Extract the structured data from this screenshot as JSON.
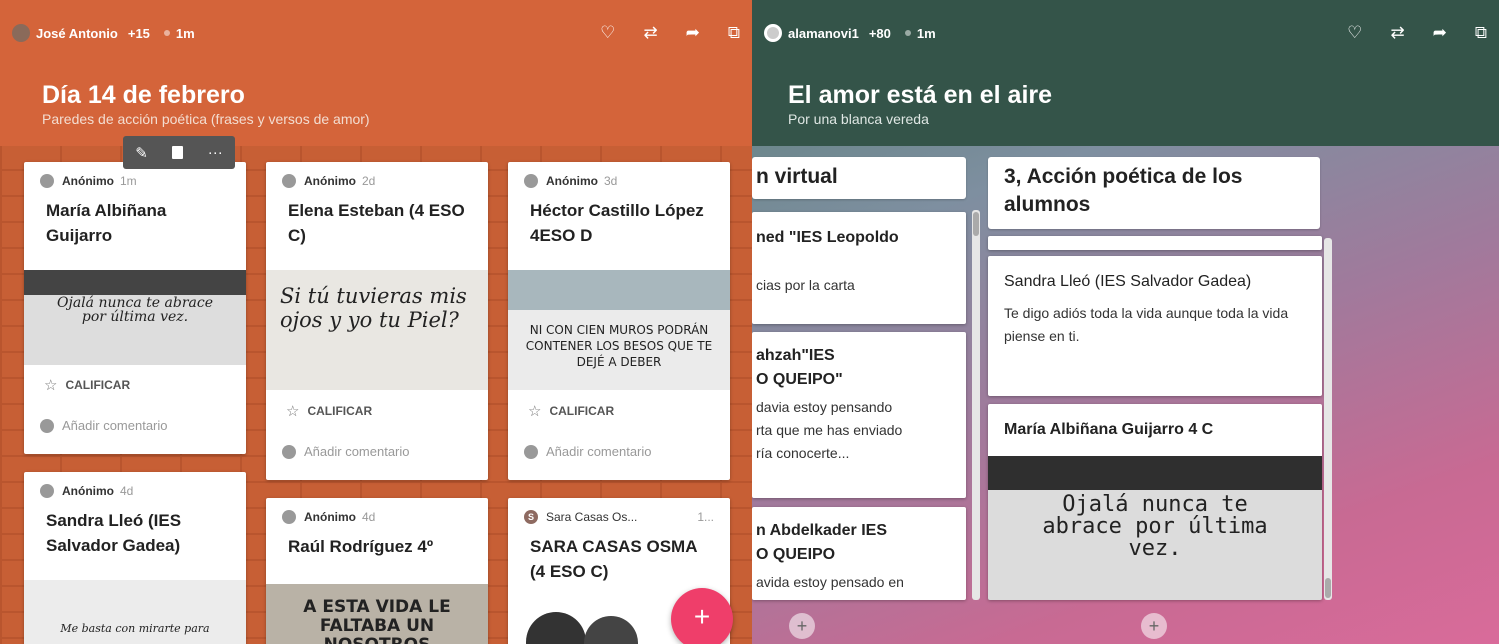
{
  "left": {
    "topbar": {
      "user": "José Antonio",
      "count": "+15",
      "time": "1m"
    },
    "header": {
      "title": "Día 14 de febrero",
      "subtitle": "Paredes de acción poética (frases y versos de amor)"
    },
    "toolbar": {
      "edit": "✎",
      "delete": "🗑",
      "more": "···"
    },
    "cards": [
      {
        "author": "Anónimo",
        "time": "1m",
        "title": "María Albiñana Guijarro",
        "image_text": "Ojalá nunca te abrace por última vez.",
        "rate": "CALIFICAR",
        "comment": "Añadir comentario"
      },
      {
        "author": "Anónimo",
        "time": "2d",
        "title": "Elena Esteban (4 ESO C)",
        "image_text": "Si tú tuvieras mis ojos y yo tu Piel?",
        "rate": "CALIFICAR",
        "comment": "Añadir comentario"
      },
      {
        "author": "Anónimo",
        "time": "3d",
        "title": "Héctor Castillo López 4ESO D",
        "image_text": "NI CON CIEN MUROS PODRÁN CONTENER LOS BESOS QUE TE DEJÉ A DEBER",
        "rate": "CALIFICAR",
        "comment": "Añadir comentario"
      },
      {
        "author": "Anónimo",
        "time": "4d",
        "title": "Sandra Lleó (IES Salvador Gadea)",
        "image_text": "Me basta con mirarte para"
      },
      {
        "author": "Anónimo",
        "time": "4d",
        "title": "Raúl Rodríguez 4º",
        "image_text": "A ESTA VIDA LE FALTABA UN NOSOTROS"
      },
      {
        "author": "Sara Casas Os...",
        "time": "1...",
        "title": "SARA CASAS OSMA (4 ESO C)",
        "avatar_letter": "S"
      }
    ],
    "fab": "+"
  },
  "right": {
    "topbar": {
      "user": "alamanovi1",
      "count": "+80",
      "time": "1m"
    },
    "header": {
      "title": "El amor está en el aire",
      "subtitle": "Por una blanca vereda"
    },
    "col1": {
      "header": "n virtual",
      "cards": [
        {
          "title": "ned \"IES Leopoldo",
          "body": "cias por la carta"
        },
        {
          "title": "ahzah\"IES\nO QUEIPO\"",
          "body": "davia estoy pensando\nrta que me has enviado\nría conocerte..."
        },
        {
          "title": "n Abdelkader IES\nO QUEIPO",
          "body": "avida estoy pensado en"
        }
      ]
    },
    "col2": {
      "header": "3, Acción poética de los alumnos",
      "cards": [
        {
          "title": "Sandra Lleó (IES Salvador Gadea)",
          "body": "Te digo adiós toda la vida aunque toda la vida piense en ti."
        },
        {
          "title": "María Albiñana Guijarro 4 C",
          "image_text": "Ojalá nunca te abrace por última vez."
        }
      ]
    },
    "add": "+"
  },
  "icons": {
    "like": "♡",
    "repost": "⇄",
    "share": "➦",
    "open": "⧉",
    "star": "☆",
    "plus": "+"
  }
}
